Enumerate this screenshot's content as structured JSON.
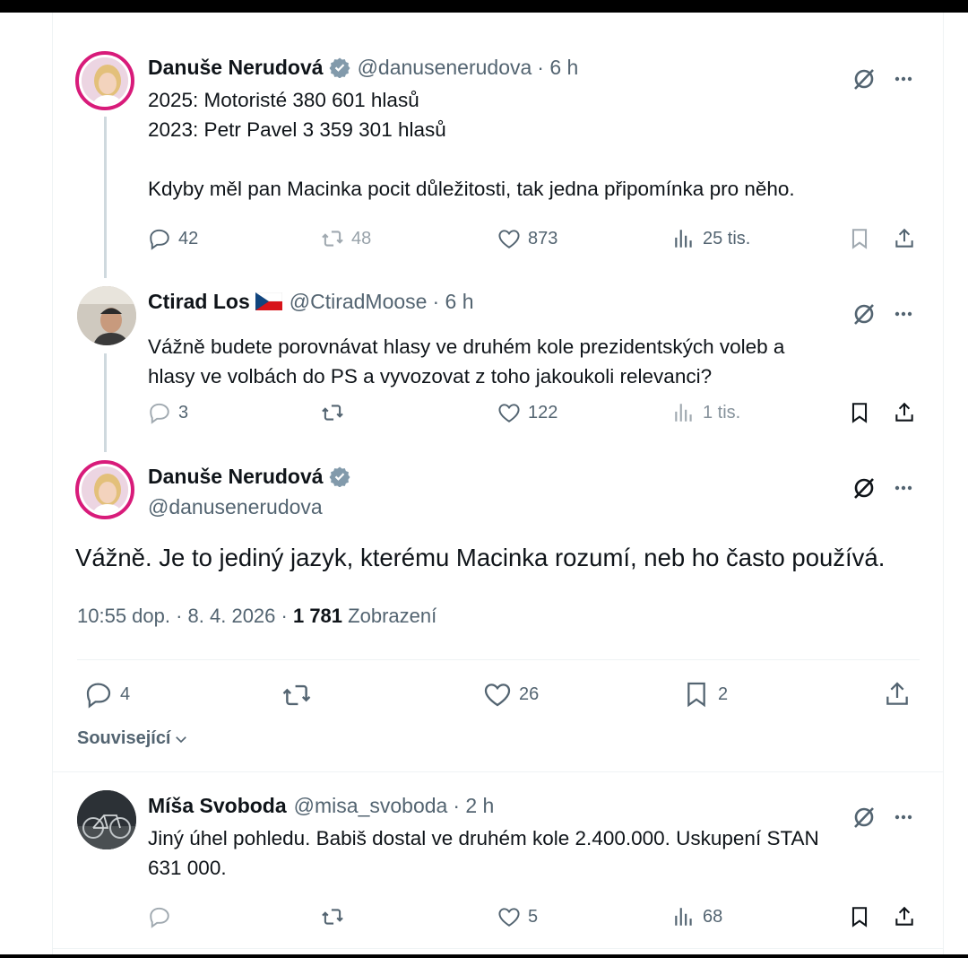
{
  "posts": [
    {
      "author": "Danuše Nerudová",
      "handle": "@danusenerudova",
      "time": "· 6 h",
      "text": "2025: Motoristé 380 601 hlasů\n2023: Petr Pavel 3 359 301 hlasů\n\nKdyby měl pan Macinka pocit důležitosti, tak jedna připomínka pro něho.",
      "replies": "42",
      "reposts": "48",
      "likes": "873",
      "views": "25 tis."
    },
    {
      "author": "Ctirad Los",
      "handle": "@CtiradMoose",
      "time": "· 6 h",
      "text": "Vážně budete porovnávat hlasy ve druhém kole prezidentských voleb a\nhlasy ve volbách do PS a vyvozovat z toho jakoukoli relevanci?",
      "replies": "3",
      "likes": "122",
      "views": "1 tis."
    }
  ],
  "main_post": {
    "author": "Danuše Nerudová",
    "handle": "@danusenerudova",
    "text": "Vážně. Je to jediný jazyk, kterému Macinka rozumí, neb ho často používá.",
    "time_date": "10:55 dop. · 8. 4. 2026 ·",
    "views_count": "1 781",
    "views_label": "Zobrazení",
    "replies": "4",
    "likes": "26",
    "bookmarks": "2"
  },
  "related_label": "Související",
  "reply": {
    "author": "Míša Svoboda",
    "handle": "@misa_svoboda",
    "time": "· 2 h",
    "text": "Jiný úhel pohledu. Babiš dostal ve druhém kole 2.400.000. Uskupení STAN\n631 000.",
    "likes": "5",
    "views": "68"
  },
  "colors": {
    "verified": "#829aab",
    "secondary_text": "#536471",
    "avatar_ring": "#d81b7a"
  }
}
